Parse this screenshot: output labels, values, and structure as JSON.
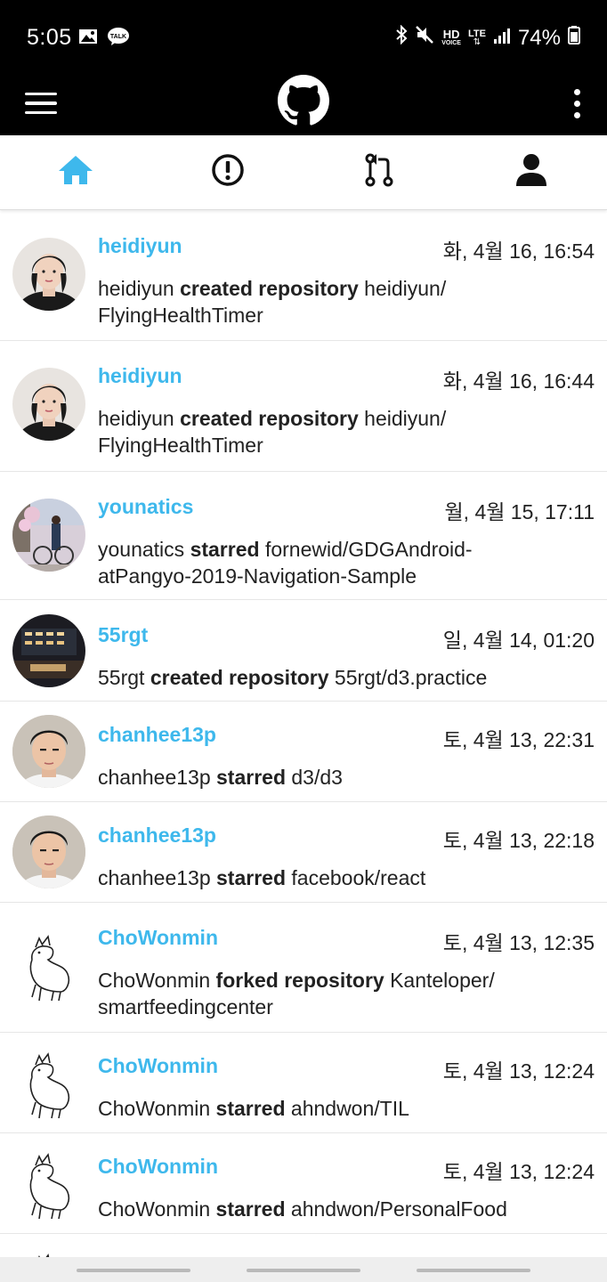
{
  "status": {
    "time": "5:05",
    "battery": "74%",
    "hd": "HD",
    "voice": "VOICE",
    "lte": "LTE"
  },
  "tabs": [
    {
      "name": "home",
      "icon": "home-icon",
      "active": true
    },
    {
      "name": "issues",
      "icon": "issue-icon",
      "active": false
    },
    {
      "name": "pulls",
      "icon": "pull-request-icon",
      "active": false
    },
    {
      "name": "profile",
      "icon": "person-icon",
      "active": false
    }
  ],
  "colors": {
    "accent": "#3eb8ec",
    "bar": "#000000"
  },
  "feed": [
    {
      "user": "heidiyun",
      "date": "화, 4월 16, 16:54",
      "action": "created repository",
      "line1_repo": "heidiyun/",
      "line2": "FlyingHealthTimer"
    },
    {
      "user": "heidiyun",
      "date": "화, 4월 16, 16:44",
      "action": "created repository",
      "line1_repo": "heidiyun/",
      "line2": "FlyingHealthTimer"
    },
    {
      "user": "younatics",
      "date": "월, 4월 15, 17:11",
      "action": "starred",
      "line1_repo": "fornewid/GDGAndroid-",
      "line2": "atPangyo-2019-Navigation-Sample"
    },
    {
      "user": "55rgt",
      "date": "일, 4월 14, 01:20",
      "action": "created repository",
      "line1_repo": "55rgt/d3.practice",
      "line2": ""
    },
    {
      "user": "chanhee13p",
      "date": "토, 4월 13, 22:31",
      "action": "starred",
      "line1_repo": "d3/d3",
      "line2": ""
    },
    {
      "user": "chanhee13p",
      "date": "토, 4월 13, 22:18",
      "action": "starred",
      "line1_repo": "facebook/react",
      "line2": ""
    },
    {
      "user": "ChoWonmin",
      "date": "토, 4월 13, 12:35",
      "action": "forked repository",
      "line1_repo": "Kanteloper/",
      "line2": "smartfeedingcenter"
    },
    {
      "user": "ChoWonmin",
      "date": "토, 4월 13, 12:24",
      "action": "starred",
      "line1_repo": "ahndwon/TIL",
      "line2": ""
    },
    {
      "user": "ChoWonmin",
      "date": "토, 4월 13, 12:24",
      "action": "starred",
      "line1_repo": "ahndwon/PersonalFood",
      "line2": ""
    }
  ]
}
